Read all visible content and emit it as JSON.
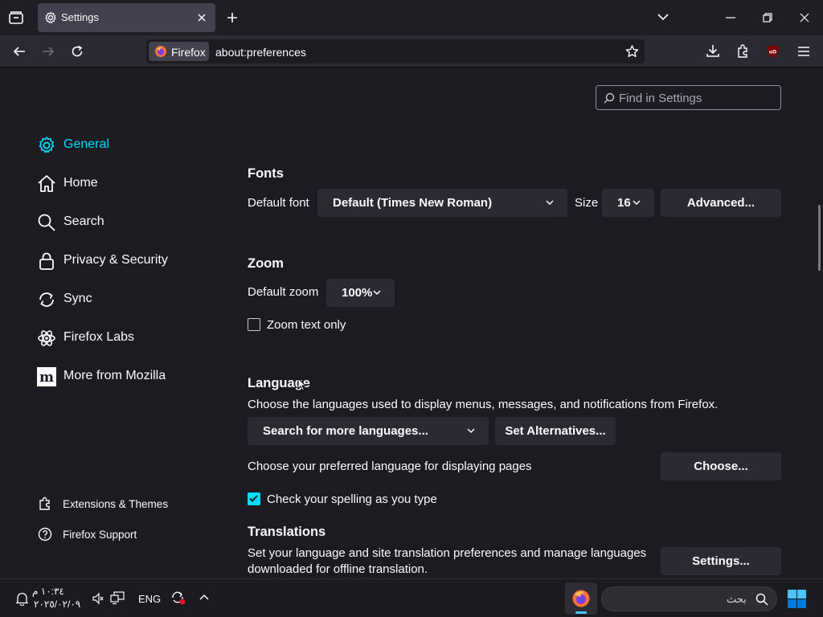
{
  "tab": {
    "title": "Settings"
  },
  "nav": {
    "identity_label": "Firefox",
    "url": "about:preferences"
  },
  "search": {
    "placeholder": "Find in Settings"
  },
  "categories": [
    {
      "label": "General",
      "icon": "gear-icon",
      "selected": true
    },
    {
      "label": "Home",
      "icon": "home-icon"
    },
    {
      "label": "Search",
      "icon": "search-icon"
    },
    {
      "label": "Privacy & Security",
      "icon": "lock-icon"
    },
    {
      "label": "Sync",
      "icon": "sync-icon"
    },
    {
      "label": "Firefox Labs",
      "icon": "flask-icon"
    },
    {
      "label": "More from Mozilla",
      "icon": "mozilla-icon"
    }
  ],
  "footer": {
    "extensions_label": "Extensions & Themes",
    "support_label": "Firefox Support"
  },
  "fonts": {
    "heading": "Fonts",
    "default_font_label": "Default font",
    "default_font_value": "Default (Times New Roman)",
    "size_label": "Size",
    "size_value": "16",
    "advanced_button": "Advanced..."
  },
  "zoom": {
    "heading": "Zoom",
    "default_zoom_label": "Default zoom",
    "default_zoom_value": "100%",
    "text_only_label": "Zoom text only",
    "text_only_checked": false
  },
  "language": {
    "heading": "Language",
    "description": "Choose the languages used to display menus, messages, and notifications from Firefox.",
    "search_more": "Search for more languages...",
    "set_alternatives": "Set Alternatives...",
    "preferred_label": "Choose your preferred language for displaying pages",
    "choose_button": "Choose...",
    "spellcheck_label": "Check your spelling as you type",
    "spellcheck_checked": true
  },
  "translations": {
    "heading": "Translations",
    "description_line1": "Set your language and site translation preferences and manage languages",
    "description_line2": "downloaded for offline translation.",
    "settings_button": "Settings..."
  },
  "taskbar": {
    "time": "١٠:٣٤ م",
    "date": "٢٠٢٥/٠٢/٠٩",
    "language": "ENG",
    "search_placeholder": "بحث"
  },
  "colors": {
    "accent": "#00ddff",
    "background": "#1c1b22",
    "surface": "#2b2a33"
  }
}
